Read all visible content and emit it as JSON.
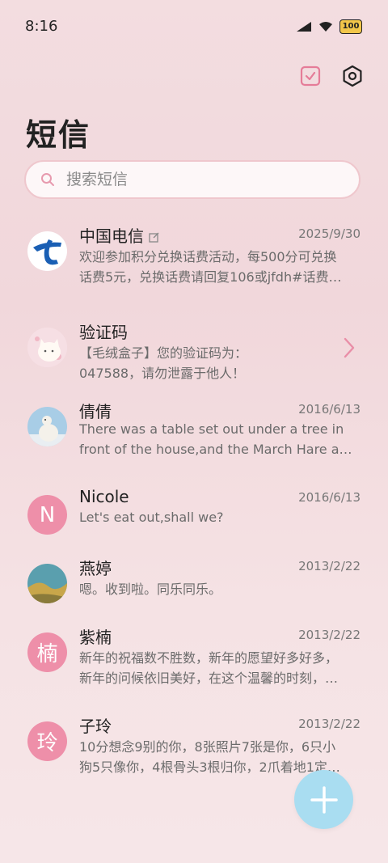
{
  "status_bar": {
    "time": "8:16",
    "battery": "100"
  },
  "page": {
    "title": "短信"
  },
  "search": {
    "placeholder": "搜索短信"
  },
  "conversations": [
    {
      "name": "中国电信",
      "date": "2025/9/30",
      "line1": "欢迎参加积分兑换话费活动，每500分可兑换",
      "line2": "话费5元，兑换话费请回复106或jfdh#话费…",
      "avatar": "china-telecom-logo"
    },
    {
      "name": "验证码",
      "date": "",
      "line1": "【毛绒盒子】您的验证码为：",
      "line2": "047588，请勿泄露于他人！",
      "avatar": "cat-photo"
    },
    {
      "name": "倩倩",
      "date": "2016/6/13",
      "line1": "There was a table set out under a tree in",
      "line2": "front of the house,and the March Hare an…",
      "avatar": "polar-bear-photo"
    },
    {
      "name": "Nicole",
      "date": "2016/6/13",
      "line1": "Let's eat out,shall we?",
      "line2": "",
      "avatar_letter": "N"
    },
    {
      "name": "燕婷",
      "date": "2013/2/22",
      "line1": "嗯。收到啦。同乐同乐。",
      "line2": "",
      "avatar": "landscape-photo"
    },
    {
      "name": "紫楠",
      "date": "2013/2/22",
      "line1": "新年的祝福数不胜数，新年的愿望好多好多，",
      "line2": "新年的问候依旧美好，在这个温馨的时刻，…",
      "avatar_letter": "楠"
    },
    {
      "name": "子玲",
      "date": "2013/2/22",
      "line1": "10分想念9别的你，8张照片7张是你，6只小",
      "line2": "狗5只像你，4根骨头3根归你，2爪着地1定…",
      "avatar_letter": "玲"
    }
  ],
  "colors": {
    "accent_pink": "#ee8fa9",
    "fab": "#a9ddf1",
    "search_border": "#efc7cd"
  }
}
